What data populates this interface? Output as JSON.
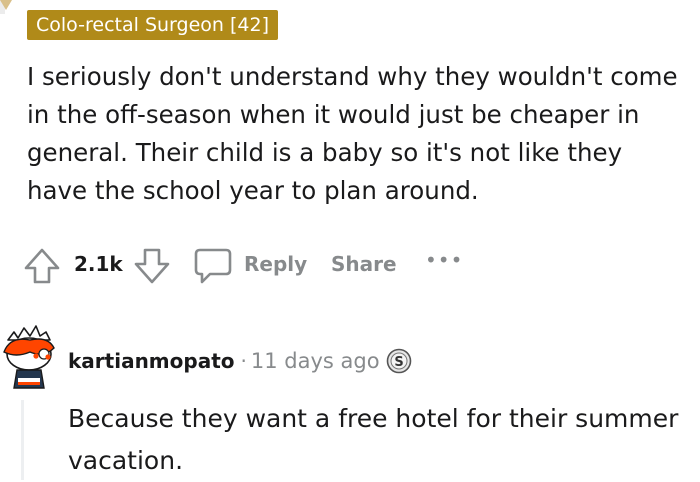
{
  "parent_comment": {
    "flair": "Colo-rectal Surgeon [42]",
    "body": "I seriously don't understand why they wouldn't come in the off-season when it would just be cheaper in general. Their child is a baby so it's not like they have the school year to plan around.",
    "vote_count": "2.1k",
    "reply_label": "Reply",
    "share_label": "Share",
    "more_label": "•••"
  },
  "reply_comment": {
    "username": "kartianmopato",
    "separator": "·",
    "timestamp": "11 days ago",
    "award_icon": "silver-award-icon",
    "body": "Because they want a free hotel for their summer vacation."
  },
  "colors": {
    "flair_bg": "#b08a19",
    "text": "#1a1a1b",
    "muted": "#878a8c",
    "avatar_hat": "#ff4500",
    "avatar_shirt": "#24374f"
  }
}
